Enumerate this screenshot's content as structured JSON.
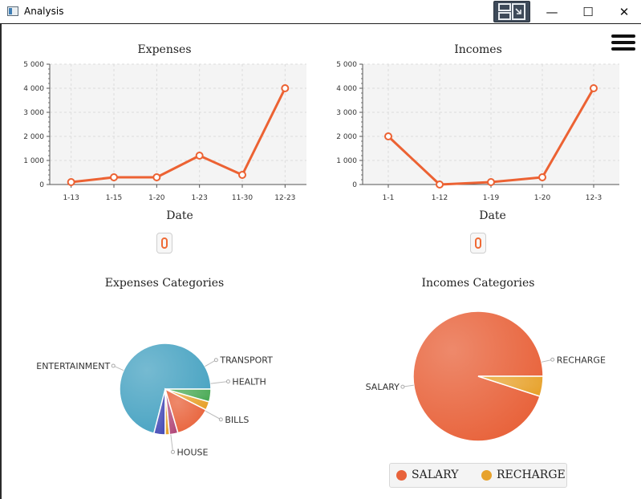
{
  "window": {
    "title": "Analysis",
    "minimize_glyph": "—",
    "maximize_glyph": "☐",
    "close_glyph": "✕"
  },
  "menu": {
    "icon": "hamburger-menu-icon"
  },
  "colors": {
    "line": "#ec6233",
    "plot_bg": "#f4f4f4",
    "grid": "#dddddd",
    "entertainment": "#48a3c2",
    "transport": "#4a4fb8",
    "health": "#b24a7a",
    "bills": "#e8623a",
    "house": "#4aaa56",
    "small": "#e7a22c",
    "salary": "#e8623a",
    "recharge": "#e7a22c"
  },
  "chart_data": [
    {
      "type": "line",
      "title": "Expenses",
      "xlabel": "Date",
      "ylabel": "",
      "categories": [
        "1-13",
        "1-15",
        "1-20",
        "1-23",
        "11-30",
        "12-23"
      ],
      "values": [
        100,
        300,
        300,
        1200,
        400,
        4000
      ],
      "ylim": [
        0,
        5000
      ],
      "yticks": [
        0,
        1000,
        2000,
        3000,
        4000,
        5000
      ],
      "ytick_labels": [
        "0",
        "1 000",
        "2 000",
        "3 000",
        "4 000",
        "5 000"
      ],
      "grid": true
    },
    {
      "type": "line",
      "title": "Incomes",
      "xlabel": "Date",
      "ylabel": "",
      "categories": [
        "1-1",
        "1-12",
        "1-19",
        "1-20",
        "12-3"
      ],
      "values": [
        2000,
        0,
        100,
        300,
        4000
      ],
      "ylim": [
        0,
        5000
      ],
      "yticks": [
        0,
        1000,
        2000,
        3000,
        4000,
        5000
      ],
      "ytick_labels": [
        "0",
        "1 000",
        "2 000",
        "3 000",
        "4 000",
        "5 000"
      ],
      "grid": true
    },
    {
      "type": "pie",
      "title": "Expenses Categories",
      "slices": [
        {
          "label": "ENTERTAINMENT",
          "value": 71
        },
        {
          "label": "TRANSPORT",
          "value": 4
        },
        {
          "label": "",
          "value": 1.5
        },
        {
          "label": "HEALTH",
          "value": 3
        },
        {
          "label": "BILLS",
          "value": 13
        },
        {
          "label": "",
          "value": 3
        },
        {
          "label": "HOUSE",
          "value": 4.5
        }
      ]
    },
    {
      "type": "pie",
      "title": "Incomes Categories",
      "slices": [
        {
          "label": "SALARY",
          "value": 95
        },
        {
          "label": "RECHARGE",
          "value": 5
        }
      ],
      "legend": [
        "SALARY",
        "RECHARGE"
      ],
      "legend_position": "bottom"
    }
  ]
}
